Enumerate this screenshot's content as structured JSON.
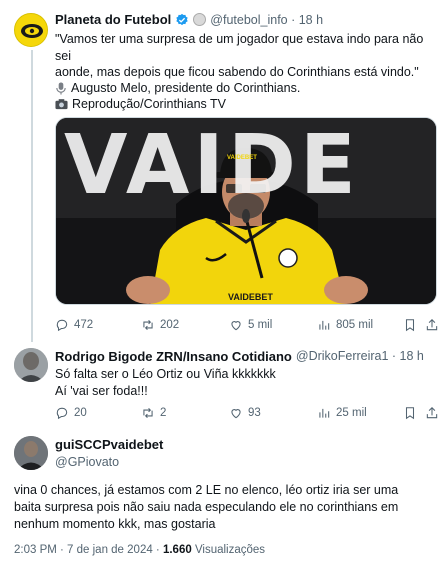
{
  "tweet1": {
    "author_name": "Planeta do Futebol",
    "handle_time": "@futebol_info · 18 h",
    "line1": "\"Vamos ter uma surpresa de um jogador que estava indo para não sei",
    "line2": "aonde, mas depois que ficou sabendo do Corinthians está vindo.\"",
    "credit1": "Augusto Melo, presidente do Corinthians.",
    "credit2": "Reprodução/Corinthians TV",
    "media_text_bg": "VAIDE",
    "cap_text": "VAIDEBET",
    "shirt_text": "VAIDEBET",
    "replies": "472",
    "retweets": "202",
    "likes": "5 mil",
    "views": "805 mil"
  },
  "tweet2": {
    "author_name": "Rodrigo Bigode ZRN/Insano Cotidiano",
    "handle_time": "@DrikoFerreira1 · 18 h",
    "line1": "Só falta ser o Léo Ortiz ou Viña kkkkkkk",
    "line2": "Aí 'vai ser foda!!!",
    "replies": "20",
    "retweets": "2",
    "likes": "93",
    "views": "25 mil"
  },
  "tweet3": {
    "author_name": "guiSCCPvaidebet",
    "handle": "@GPiovato",
    "line1": "vina 0 chances, já estamos com 2 LE no elenco, léo ortiz iria ser uma",
    "line2": "baita surpresa pois não saiu nada especulando ele no corinthians em",
    "line3": "nenhum momento kkk, mas gostaria",
    "meta_time": "2:03 PM · 7 de jan de 2024 · ",
    "views_count": "1.660",
    "views_label": " Visualizações"
  },
  "colors": {
    "verified_blue": "#1d9bf0",
    "muted": "#536471",
    "yellow": "#f5d70a"
  },
  "icons": [
    "reply-icon",
    "retweet-icon",
    "like-icon",
    "views-icon",
    "bookmark-icon",
    "share-icon",
    "verified-icon",
    "mic-icon",
    "camera-icon"
  ]
}
